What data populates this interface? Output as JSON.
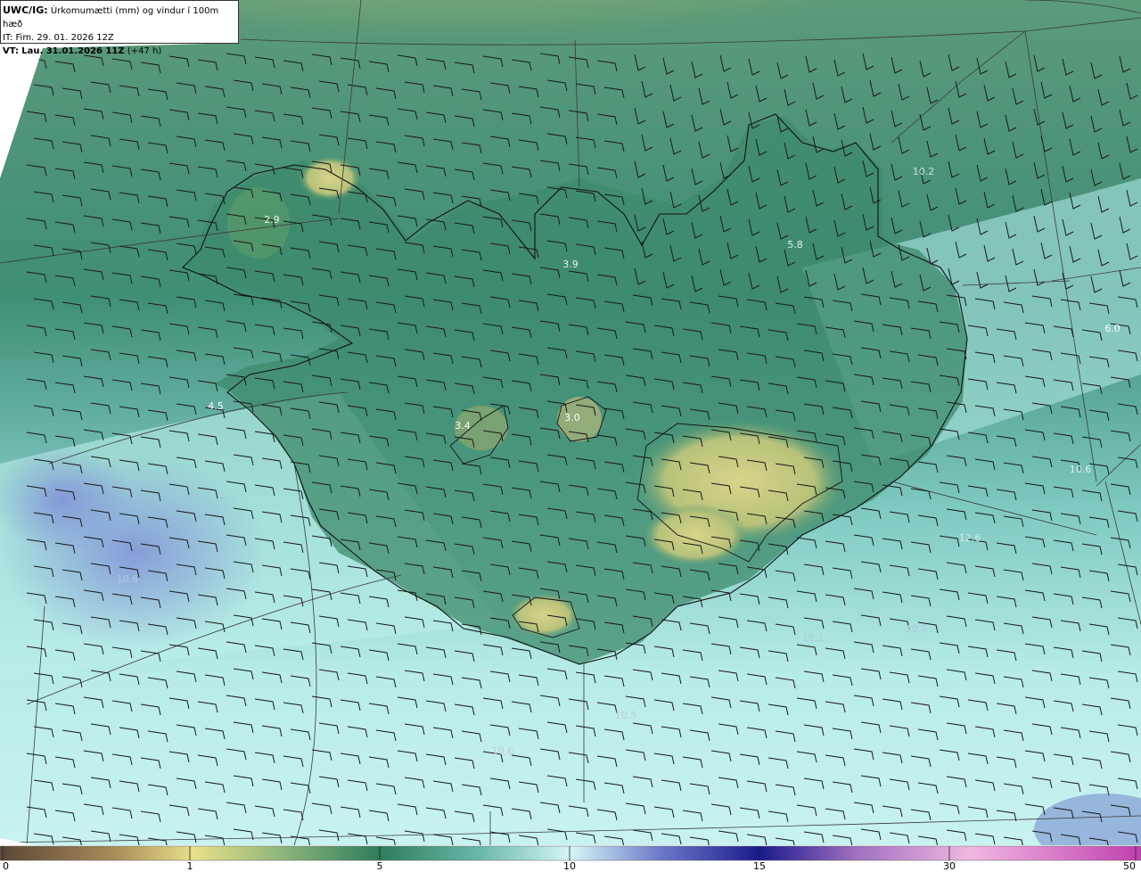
{
  "header": {
    "model": "UWC/IG:",
    "title": "Úrkomumætti (mm) og vindur í 100m hæð",
    "it_label": "IT:",
    "it_value": "Fim. 29. 01. 2026 12Z",
    "vt_label": "VT:",
    "vt_value": "Lau. 31.01.2026 11Z",
    "vt_offset": "(+47 h)"
  },
  "colorbar": {
    "ticks": [
      "0",
      "1",
      "5",
      "10",
      "15",
      "30",
      "50"
    ],
    "colors": {
      "brown": "#6b4e3a",
      "yellow": "#e8e08a",
      "green": "#2e7d5c",
      "lightcyan": "#d6f6f6",
      "darkblue": "#1a1a8c",
      "magenta": "#c040b0"
    }
  },
  "value_labels": [
    {
      "text": "2.9",
      "color": "#f0f0e0"
    },
    {
      "text": "3.9",
      "color": "#f0f0e0"
    },
    {
      "text": "5.8",
      "color": "#e0f0ea"
    },
    {
      "text": "10.2",
      "color": "#c0e6e2"
    },
    {
      "text": "6.0",
      "color": "#ffffff"
    },
    {
      "text": "4.5",
      "color": "#ffffff"
    },
    {
      "text": "3.4",
      "color": "#ffffff"
    },
    {
      "text": "3.0",
      "color": "#ffffff"
    },
    {
      "text": "10.6",
      "color": "#d8f2f0"
    },
    {
      "text": "10.6",
      "color": "#b0c8de"
    },
    {
      "text": "12.6",
      "color": "#d8e4f4"
    },
    {
      "text": "10.1",
      "color": "#b0c8d8"
    },
    {
      "text": "10.4",
      "color": "#b0c8d8"
    },
    {
      "text": "10.5",
      "color": "#c0c8dc"
    },
    {
      "text": "10.6",
      "color": "#c0c8dc"
    }
  ]
}
